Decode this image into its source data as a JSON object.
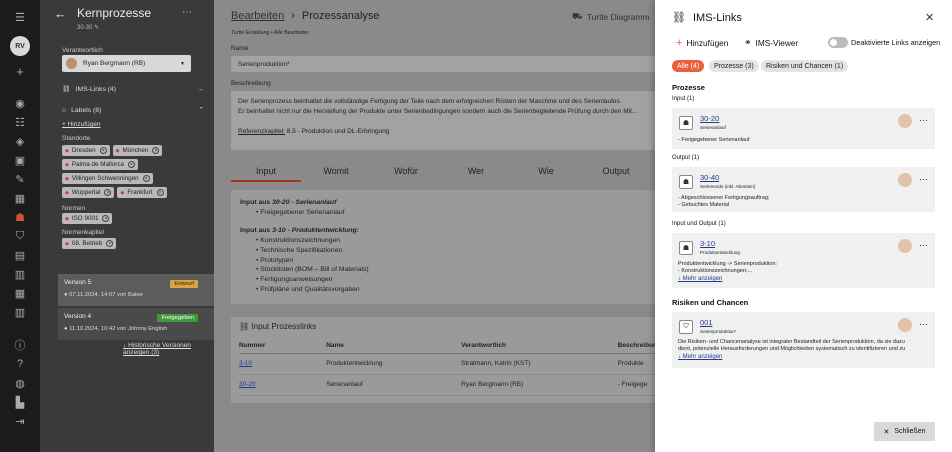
{
  "rail": {
    "avatar": "RV"
  },
  "sidebar": {
    "title": "Kernprozesse",
    "subtitle": "30-30 ✎",
    "owner_label": "Verantwortlich",
    "owner": "Ryan Bergmann (RB)",
    "ims_links": "IMS-Links (4)",
    "labels": "Labels (8)",
    "add": "+ Hinzufügen",
    "locations_label": "Standorte",
    "locations": [
      "Dresden",
      "München",
      "Palma de Mallorca",
      "Villingen Schwenningen",
      "Wuppertal",
      "Frankfurt"
    ],
    "norms_label": "Normen",
    "norms": [
      "ISO 9001"
    ],
    "norm_chapter_label": "Normenkapitel",
    "norm_chapters": [
      "08. Betrieb"
    ],
    "versions": [
      {
        "name": "Version 5",
        "badge": "Entwurf",
        "badge_color": "#d9a441",
        "date": "07.11.2024, 14:07 von Baker"
      },
      {
        "name": "Version 4",
        "badge": "Freigegeben",
        "badge_color": "#3d9a3d",
        "date": "11.10.2024, 10:42 von Johnny English"
      }
    ],
    "history": "Historische Versionen anzeigen (3)"
  },
  "main": {
    "breadcrumb_link": "Bearbeiten",
    "breadcrumb_current": "Prozessanalyse",
    "turtle": "Turtle Diagramm",
    "meta_left": "Turtle Erstellung",
    "meta_right": "Alle Bearbeiter",
    "name_label": "Name",
    "name_value": "Serienproduktion*",
    "desc_label": "Beschreibung",
    "desc_line1": "Der Serienprozess beinhaltet die vollständige Fertigung der Teile nach dem erfolgreichen Rüsten der Maschine und des Serienlaufes.",
    "desc_line2": "Er beinhaltet nicht nur die Herstellung der Produkte unter Serienbedingungen sondern auch die Serienbegleitende Prüfung durch den Mit...",
    "ref_label": "Referenzkapitel:",
    "ref_value": "8.5 - Produktion und DL-Erbringung",
    "tabs": [
      "Input",
      "Womit",
      "Wofür",
      "Wer",
      "Wie",
      "Output"
    ],
    "input1_head_pre": "Input aus ",
    "input1_head_code": "30-20",
    "input1_head_post": " - Serienanlauf",
    "input1_items": [
      "Freigegebener Serienanlauf"
    ],
    "input2_head_pre": "Input aus ",
    "input2_head_code": "3-10",
    "input2_head_post": " - Produktentwicklung:",
    "input2_items": [
      "Konstruktionszeichnungen",
      "Technische Spezifikationen",
      "Prototypen",
      "Stücklisten (BOM – Bill of Materials)",
      "Fertigungsanweisungen",
      "Prüfpläne und Qualitätsvorgaben"
    ],
    "plinks_title": "Input Prozesslinks",
    "plinks_cols": [
      "Nummer",
      "Name",
      "Verantwortlich",
      "Beschreibung"
    ],
    "plinks_rows": [
      {
        "num": "3-10",
        "name": "Produktentwicklung",
        "owner": "Stratmann, Katrin (KST)",
        "desc": "Produkte"
      },
      {
        "num": "30-20",
        "name": "Serienanlauf",
        "owner": "Ryan Bergmann (RB)",
        "desc": "- Freigege"
      }
    ]
  },
  "drawer": {
    "title": "IMS-Links",
    "add": "Hinzufügen",
    "viewer": "IMS-Viewer",
    "toggle_label": "Deaktivierte Links anzeigen",
    "filters": [
      "Alle (4)",
      "Prozesse (3)",
      "Risiken und Chancen (1)"
    ],
    "accent": "#e8603c",
    "processes_title": "Prozesse",
    "input_label": "Input (1)",
    "output_label": "Output (1)",
    "io_label": "Input und Output (1)",
    "risks_title": "Risiken und Chancen",
    "links": [
      {
        "code": "30-20",
        "name": "Serienanlauf",
        "desc": "- Freigegebener Serienanlauf",
        "more": ""
      },
      {
        "code": "30-40",
        "name": "Serienende (inkl. Abrüsten)",
        "desc": "- Abgeschlossener Fertigungsauftrag;\n- Gebuchtes Material",
        "more": ""
      },
      {
        "code": "3-10",
        "name": "Produktentwicklung",
        "desc": "Produktentwicklung -> Serienproduktion:\n- Konstruktionszeichnungen;...",
        "more": "Mehr anzeigen"
      },
      {
        "code": "001",
        "name": "Serienproduktion*",
        "desc": "Die Risiken- und Chancenanalyse ist integraler Bestandteil der Serienproduktion, da sie dazu\ndient, potenzielle Herausforderungen und Möglichkeiten systematisch zu identifizieren und zu",
        "more": "Mehr anzeigen"
      }
    ],
    "close_button": "Schließen"
  }
}
